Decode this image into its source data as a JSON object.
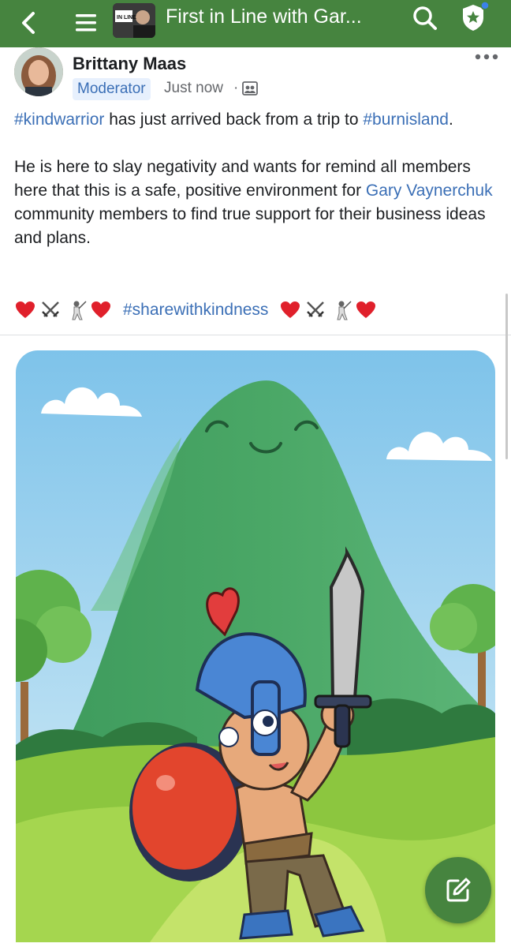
{
  "header": {
    "group_title": "First in Line with Gar...",
    "group_thumb_text": "IN LINE"
  },
  "post": {
    "author": "Brittany Maas",
    "badge": "Moderator",
    "time": "Just now",
    "separator": "·",
    "paragraph1": {
      "tag1": "#kindwarrior",
      "text1": " has just arrived back from a trip to ",
      "tag2": "#burnisland",
      "text2": "."
    },
    "paragraph2": {
      "text1": "He is here to slay negativity and wants for remind all members here that this is a safe, positive environment for ",
      "link": "Gary Vaynerchuk",
      "text2": " community members to find true support for their business ideas and plans."
    },
    "emoji_hashtag": "#sharewithkindness",
    "image_icon": "cartoon-warrior-image"
  },
  "icons": {
    "back": "chevron-left-icon",
    "menu": "hamburger-icon",
    "search": "search-icon",
    "shield": "admin-shield-icon",
    "more": "more-icon",
    "privacy": "group-privacy-icon",
    "compose": "compose-icon"
  },
  "colors": {
    "brand_green": "#46843f",
    "link_blue": "#3b6fb6"
  }
}
